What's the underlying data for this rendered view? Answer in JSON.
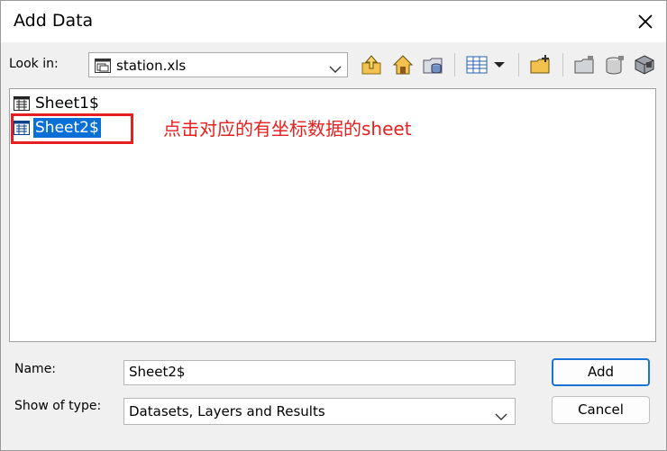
{
  "window": {
    "title": "Add Data"
  },
  "lookin": {
    "label": "Look in:",
    "value": "station.xls"
  },
  "toolbar": {
    "icons": [
      "up-folder-icon",
      "home-icon",
      "database-folder-icon",
      "list-view-icon",
      "view-dropdown-icon",
      "new-folder-icon",
      "connect-folder-icon",
      "disconnect-icon",
      "database-connect-icon"
    ]
  },
  "list": {
    "items": [
      {
        "label": "Sheet1$",
        "selected": false
      },
      {
        "label": "Sheet2$",
        "selected": true
      }
    ],
    "annotation": "点击对应的有坐标数据的sheet"
  },
  "name": {
    "label": "Name:",
    "value": "Sheet2$"
  },
  "type": {
    "label": "Show of type:",
    "value": "Datasets, Layers and Results"
  },
  "buttons": {
    "add": "Add",
    "cancel": "Cancel"
  },
  "colors": {
    "selection": "#0a6fd6",
    "annotation": "#e62020",
    "primary_border": "#1a73d8"
  }
}
